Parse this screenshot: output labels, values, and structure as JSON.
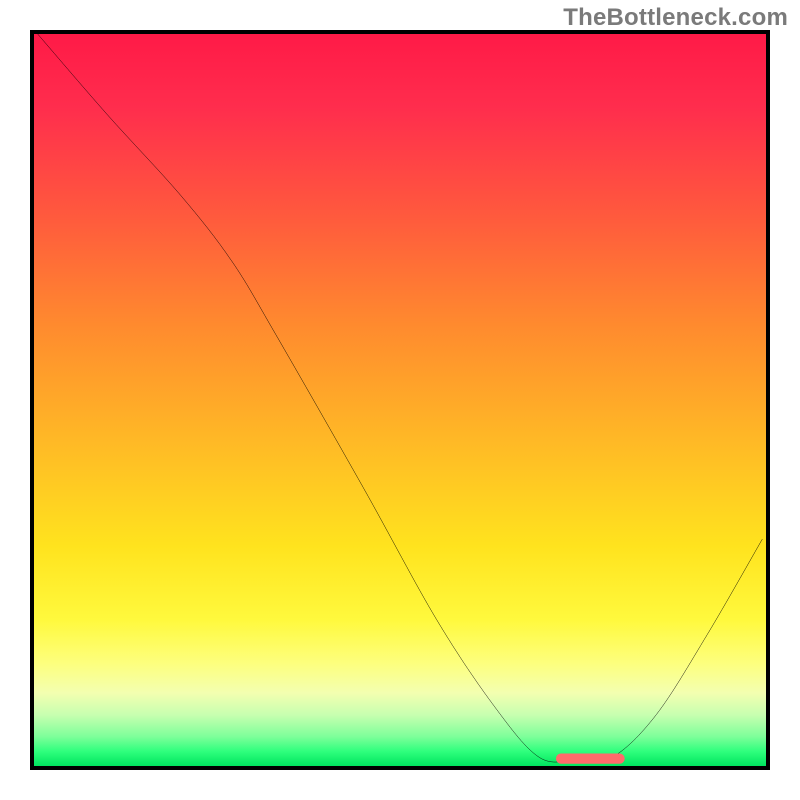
{
  "watermark": {
    "text": "TheBottleneck.com"
  },
  "chart_data": {
    "type": "line",
    "title": "",
    "xlabel": "",
    "ylabel": "",
    "xlim": [
      0,
      100
    ],
    "ylim": [
      0,
      100
    ],
    "curve_points": [
      {
        "x": 0.5,
        "y": 100
      },
      {
        "x": 10,
        "y": 89
      },
      {
        "x": 20,
        "y": 78
      },
      {
        "x": 27,
        "y": 69
      },
      {
        "x": 33,
        "y": 59
      },
      {
        "x": 45,
        "y": 38
      },
      {
        "x": 55,
        "y": 20
      },
      {
        "x": 63,
        "y": 8
      },
      {
        "x": 69,
        "y": 1.2
      },
      {
        "x": 74,
        "y": 0.8
      },
      {
        "x": 79,
        "y": 1.2
      },
      {
        "x": 85,
        "y": 7
      },
      {
        "x": 92,
        "y": 18
      },
      {
        "x": 99.5,
        "y": 31
      }
    ],
    "optimal_marker": {
      "x_start": 72,
      "x_end": 80,
      "y": 1.0,
      "color": "#ff6b6b",
      "thickness": 10
    },
    "gradient_stops": [
      {
        "pos": 0,
        "color": "#ff1a47"
      },
      {
        "pos": 25,
        "color": "#ff5a3d"
      },
      {
        "pos": 55,
        "color": "#ffb726"
      },
      {
        "pos": 80,
        "color": "#fff93d"
      },
      {
        "pos": 96,
        "color": "#7dff9a"
      },
      {
        "pos": 100,
        "color": "#00e55f"
      }
    ]
  }
}
